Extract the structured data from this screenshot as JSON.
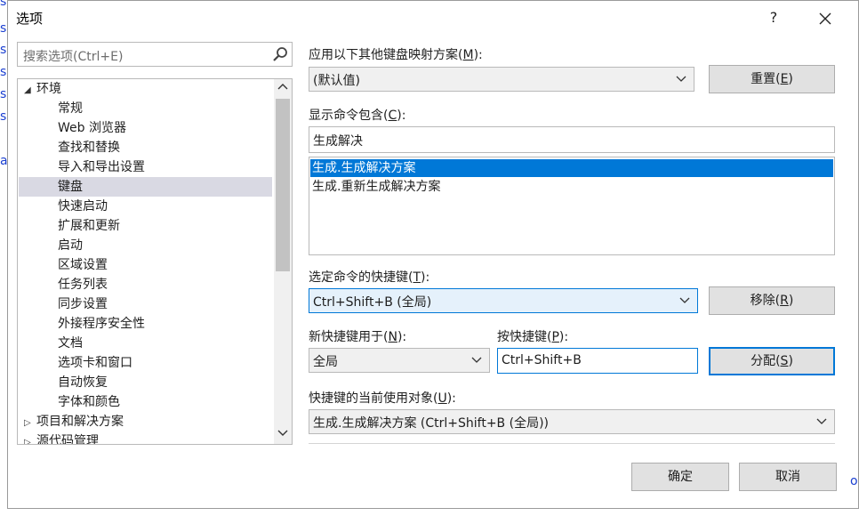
{
  "background": {
    "edge_letters": [
      "s",
      "s",
      "s",
      "s",
      "s",
      "s"
    ],
    "edge_letter_a": "a",
    "edge_letter_o": "o"
  },
  "dialog": {
    "title": "选项",
    "help_label": "?",
    "close_label": "✕"
  },
  "search": {
    "placeholder": "搜索选项(Ctrl+E)"
  },
  "tree": {
    "root": "环境",
    "children": [
      "常规",
      "Web 浏览器",
      "查找和替换",
      "导入和导出设置",
      "键盘",
      "快速启动",
      "扩展和更新",
      "启动",
      "区域设置",
      "任务列表",
      "同步设置",
      "外接程序安全性",
      "文档",
      "选项卡和窗口",
      "自动恢复",
      "字体和颜色"
    ],
    "selected_child": "键盘",
    "collapsed": [
      "项目和解决方案",
      "源代码管理"
    ]
  },
  "keyboard": {
    "mapping_label": "应用以下其他键盘映射方案(",
    "mapping_key": "M",
    "mapping_suffix": "):",
    "mapping_value": "(默认值)",
    "reset_label": "重置(",
    "reset_key": "E",
    "reset_suffix": ")",
    "show_cmds_label": "显示命令包含(",
    "show_cmds_key": "C",
    "show_cmds_suffix": "):",
    "show_cmds_value": "生成解决",
    "commands": [
      "生成.生成解决方案",
      "生成.重新生成解决方案"
    ],
    "selected_command": "生成.生成解决方案",
    "shortcut_label": "选定命令的快捷键(",
    "shortcut_key": "T",
    "shortcut_suffix": "):",
    "shortcut_value": "Ctrl+Shift+B (全局)",
    "remove_label": "移除(",
    "remove_key": "R",
    "remove_suffix": ")",
    "use_in_label": "新快捷键用于(",
    "use_in_key": "N",
    "use_in_suffix": "):",
    "use_in_value": "全局",
    "press_label": "按快捷键(",
    "press_key": "P",
    "press_suffix": "):",
    "press_value": "Ctrl+Shift+B",
    "assign_label": "分配(",
    "assign_key": "S",
    "assign_suffix": ")",
    "current_use_label": "快捷键的当前使用对象(",
    "current_use_key": "U",
    "current_use_suffix": "):",
    "current_use_value": "生成.生成解决方案 (Ctrl+Shift+B (全局))"
  },
  "footer": {
    "ok_label": "确定",
    "cancel_label": "取消"
  }
}
